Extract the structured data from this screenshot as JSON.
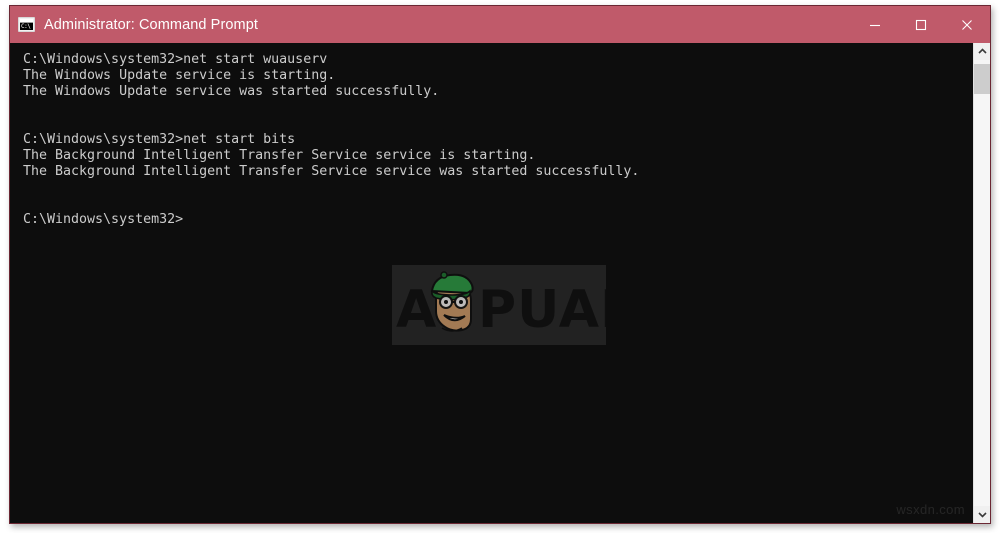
{
  "window": {
    "title": "Administrator: Command Prompt",
    "icon": "command-prompt-icon",
    "colors": {
      "titlebar": "#c05a6a",
      "console_background": "#0d0d0d",
      "console_text": "#cccccc",
      "window_border": "#6b2733",
      "scrollbar_track": "#f0f0f0",
      "scrollbar_thumb": "#cdcdcd"
    },
    "controls": {
      "minimize": "Minimize",
      "maximize": "Maximize",
      "close": "Close"
    }
  },
  "console": {
    "lines": [
      "C:\\Windows\\system32>net start wuauserv",
      "The Windows Update service is starting.",
      "The Windows Update service was started successfully.",
      "",
      "",
      "C:\\Windows\\system32>net start bits",
      "The Background Intelligent Transfer Service service is starting.",
      "The Background Intelligent Transfer Service service was started successfully.",
      "",
      "",
      "C:\\Windows\\system32>"
    ]
  },
  "watermark": {
    "brand": "APPUALS",
    "brand_first_letter": "A",
    "brand_rest": "PUALS",
    "logo_colors": {
      "beret": "#2a8a3e",
      "beret_dark": "#1d6a2d",
      "skin": "#b78a5e",
      "text": "#101010"
    }
  },
  "corner_watermark": {
    "text": "wsxdn.com"
  },
  "scrollbar": {
    "up_arrow": "chevron-up",
    "down_arrow": "chevron-down",
    "thumb_position": "top"
  }
}
